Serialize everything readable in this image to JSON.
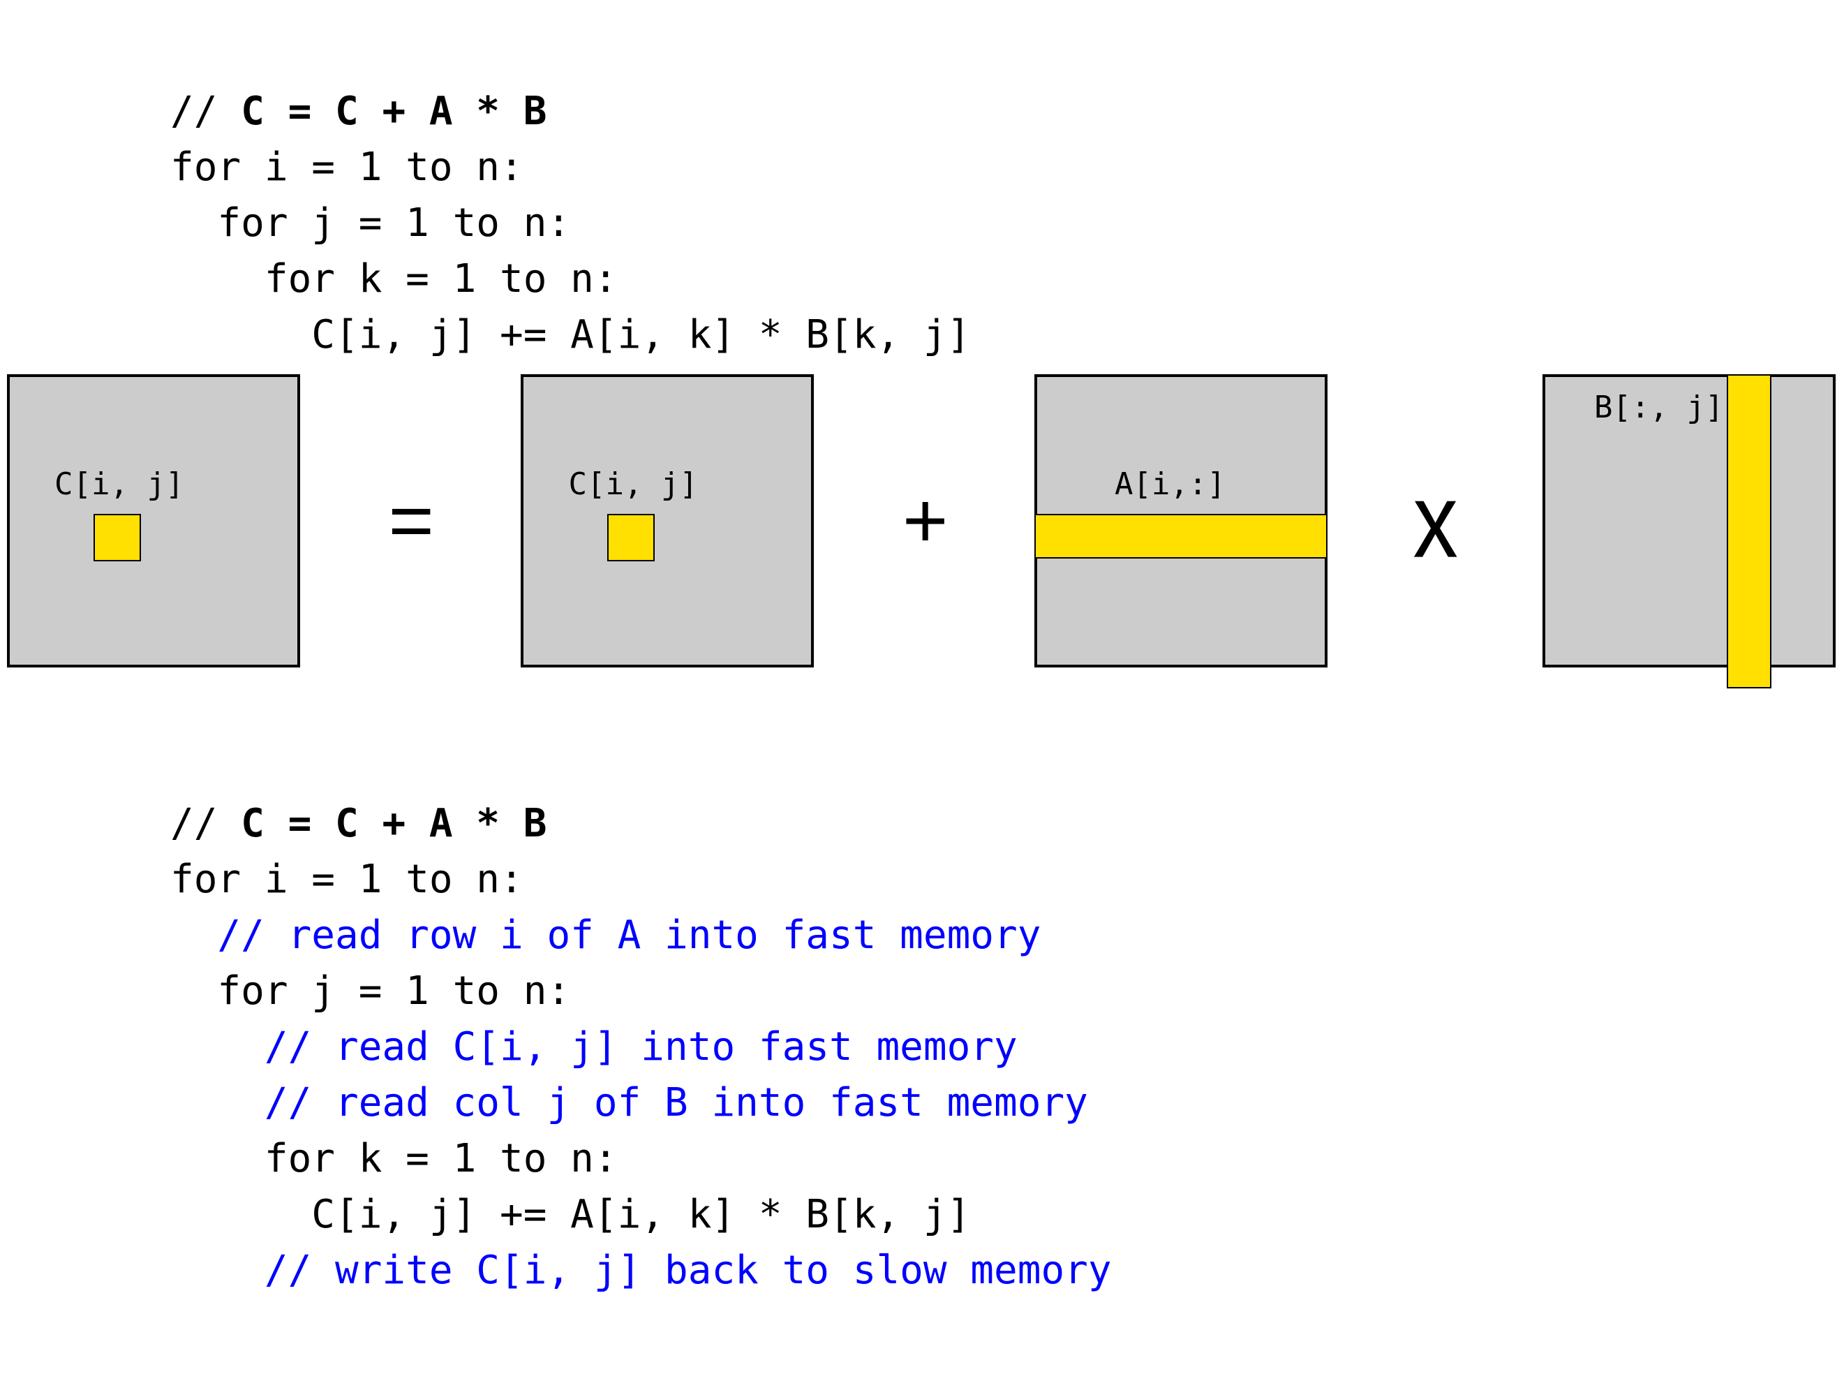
{
  "top_code": {
    "l1_prefix": "// ",
    "l1_bold": "C = C + A * B",
    "l2": "for i = 1 to n:",
    "l3": "  for j = 1 to n:",
    "l4": "    for k = 1 to n:",
    "l5": "      C[i, j] += A[i, k] * B[k, j]"
  },
  "diagram": {
    "c_label": "C[i, j]",
    "a_label": "A[i,:]",
    "b_label": "B[:, j]",
    "eq": "=",
    "plus": "+",
    "mul": "x"
  },
  "bot_code": {
    "l1_prefix": "// ",
    "l1_bold": "C = C + A * B",
    "l2": "for i = 1 to n:",
    "c3": "  // read row i of A into fast memory",
    "l4": "  for j = 1 to n:",
    "c5": "    // read C[i, j] into fast memory",
    "c6": "    // read col j of B into fast memory",
    "l7": "    for k = 1 to n:",
    "l8": "      C[i, j] += A[i, k] * B[k, j]",
    "c9": "    // write C[i, j] back to slow memory"
  }
}
